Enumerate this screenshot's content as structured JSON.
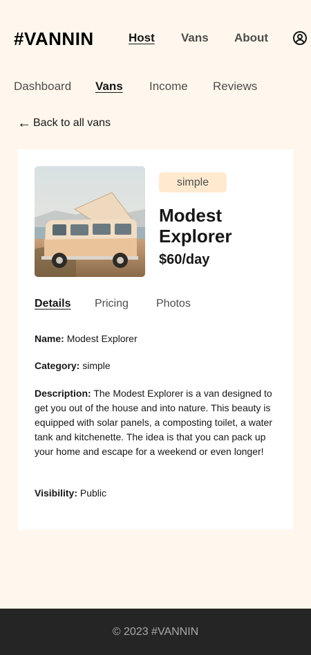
{
  "header": {
    "logo": "#VANNIN",
    "nav": [
      {
        "label": "Host",
        "active": true
      },
      {
        "label": "Vans",
        "active": false
      },
      {
        "label": "About",
        "active": false
      }
    ],
    "avatar_icon": "user-circle-icon"
  },
  "host_nav": [
    {
      "label": "Dashboard",
      "active": false
    },
    {
      "label": "Vans",
      "active": true
    },
    {
      "label": "Income",
      "active": false
    },
    {
      "label": "Reviews",
      "active": false
    }
  ],
  "back_link": {
    "arrow": "←",
    "label": "Back to all vans"
  },
  "van": {
    "type_badge": "simple",
    "name": "Modest Explorer",
    "price": "$60/day",
    "image_icon": "van-photo"
  },
  "tabs": [
    {
      "label": "Details",
      "active": true
    },
    {
      "label": "Pricing",
      "active": false
    },
    {
      "label": "Photos",
      "active": false
    }
  ],
  "details": {
    "name_label": "Name:",
    "name_value": "Modest Explorer",
    "category_label": "Category:",
    "category_value": "simple",
    "description_label": "Description:",
    "description_value": "The Modest Explorer is a van designed to get you out of the house and into nature. This beauty is equipped with solar panels, a composting toilet, a water tank and kitchenette. The idea is that you can pack up your home and escape for a weekend or even longer!",
    "visibility_label": "Visibility:",
    "visibility_value": "Public"
  },
  "footer": {
    "copyright": "© 2023 #VANNIN"
  },
  "colors": {
    "background": "#FFF7ED",
    "badge_bg": "#FFEAD0",
    "footer_bg": "#252525",
    "text": "#161616",
    "muted": "#4D4D4D"
  }
}
